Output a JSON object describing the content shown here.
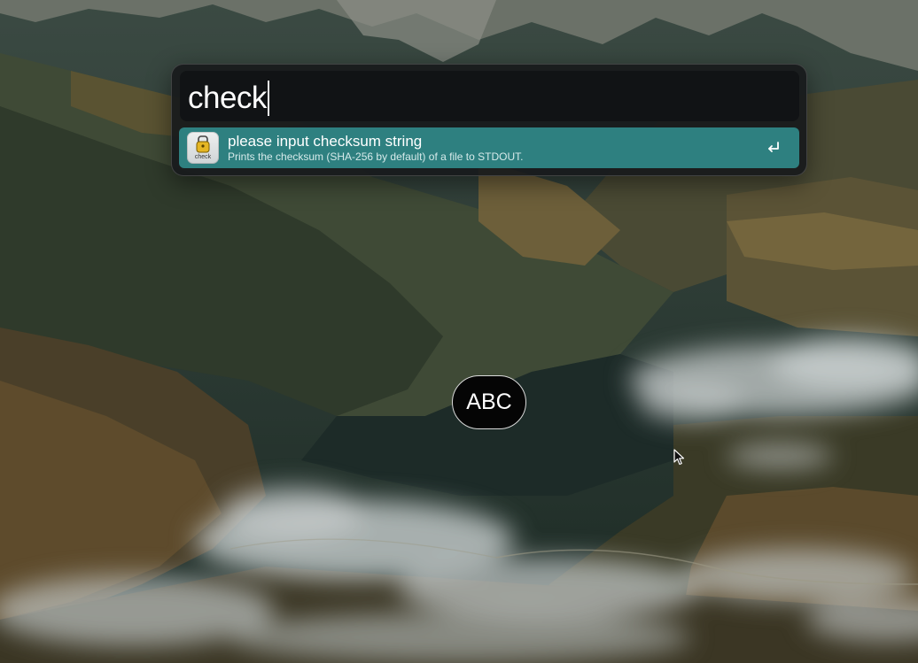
{
  "launcher": {
    "query": "check",
    "results": [
      {
        "title": "please input checksum string",
        "subtitle": "Prints the checksum (SHA-256 by default) of a file to STDOUT.",
        "icon": "check-plugin-icon",
        "icon_caption": "check",
        "action_icon": "return-key-icon"
      }
    ]
  },
  "input_source": {
    "label": "ABC"
  },
  "colors": {
    "result_highlight": "#2e8080",
    "launcher_bg": "#181a1c",
    "search_bg": "#111315"
  }
}
